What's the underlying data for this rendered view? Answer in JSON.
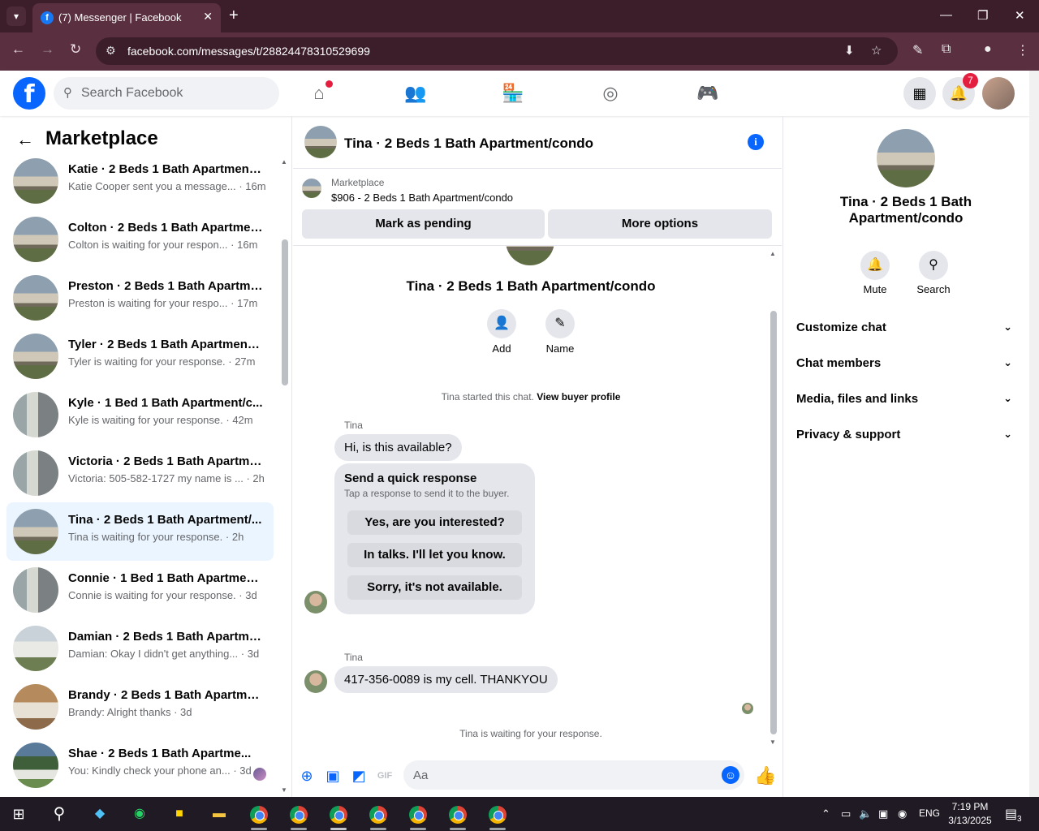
{
  "browser": {
    "tab_title": "(7) Messenger | Facebook",
    "url": "facebook.com/messages/t/28824478310529699"
  },
  "fb": {
    "search_placeholder": "Search Facebook",
    "notifications_count": "7"
  },
  "left": {
    "title": "Marketplace",
    "conversations": [
      {
        "name": "Katie · 2 Beds 1 Bath Apartment/...",
        "preview": "Katie Cooper sent you a message...",
        "time": "· 16m",
        "photo": "house"
      },
      {
        "name": "Colton · 2 Beds 1 Bath Apartmen...",
        "preview": "Colton is waiting for your respon...",
        "time": "· 16m",
        "photo": "house"
      },
      {
        "name": "Preston · 2 Beds 1 Bath Apartme...",
        "preview": "Preston is waiting for your respo...",
        "time": "· 17m",
        "photo": "house"
      },
      {
        "name": "Tyler · 2 Beds 1 Bath Apartment/...",
        "preview": "Tyler is waiting for your response.",
        "time": "· 27m",
        "photo": "house"
      },
      {
        "name": "Kyle · 1 Bed 1 Bath Apartment/c...",
        "preview": "Kyle is waiting for your response.",
        "time": "· 42m",
        "photo": "kitchen"
      },
      {
        "name": "Victoria · 2 Beds 1 Bath Apartme...",
        "preview": "Victoria: 505-582-1727 my name is ...",
        "time": "· 2h",
        "photo": "kitchen"
      },
      {
        "name": "Tina · 2 Beds 1 Bath Apartment/...",
        "preview": "Tina is waiting for your response.",
        "time": "· 2h",
        "photo": "house",
        "active": true
      },
      {
        "name": "Connie · 1 Bed 1 Bath Apartment...",
        "preview": "Connie is waiting for your response.",
        "time": "· 3d",
        "photo": "kitchen"
      },
      {
        "name": "Damian · 2 Beds 1 Bath Apartme...",
        "preview": "Damian: Okay I didn't get anything...",
        "time": "· 3d",
        "photo": "white"
      },
      {
        "name": "Brandy · 2 Beds 1 Bath Apartme...",
        "preview": "Brandy: Alright thanks",
        "time": "· 3d",
        "photo": "kitchen2"
      },
      {
        "name": "Shae · 2 Beds 1 Bath Apartme...",
        "preview": "You: Kindly check your phone an...",
        "time": "· 3d",
        "photo": "trees"
      }
    ]
  },
  "chat": {
    "header_name": "Tina · 2 Beds 1 Bath Apartment/condo",
    "marketplace_label": "Marketplace",
    "listing": "$906 - 2 Beds 1 Bath Apartment/condo",
    "mark_pending": "Mark as pending",
    "more_options": "More options",
    "thread_name": "Tina · 2 Beds 1 Bath Apartment/condo",
    "add_label": "Add",
    "name_label": "Name",
    "started_text": "Tina started this chat.",
    "buyer_profile": "View buyer profile",
    "sender": "Tina",
    "msg1": "Hi, is this available?",
    "quick_title": "Send a quick response",
    "quick_sub": "Tap a response to send it to the buyer.",
    "quick_options": [
      "Yes, are you interested?",
      "In talks. I'll let you know.",
      "Sorry, it's not available."
    ],
    "msg2": "417-356-0089  is my cell. THANKYOU",
    "waiting": "Tina is waiting for your response.",
    "composer_placeholder": "Aa"
  },
  "right": {
    "name": "Tina · 2 Beds 1 Bath Apartment/condo",
    "mute": "Mute",
    "search": "Search",
    "sections": [
      "Customize chat",
      "Chat members",
      "Media, files and links",
      "Privacy & support"
    ]
  },
  "taskbar": {
    "lang": "ENG",
    "time": "7:19 PM",
    "date": "3/13/2025",
    "notif_count": "3"
  }
}
